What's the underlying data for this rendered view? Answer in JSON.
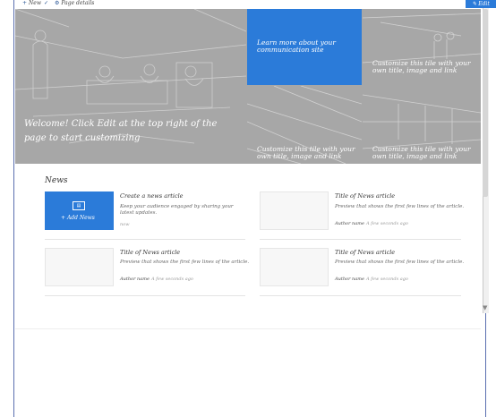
{
  "command_bar": {
    "new_label": "New",
    "details_label": "Page details",
    "edit_label": "Edit",
    "icons": [
      "plus-icon",
      "check-icon",
      "gear-icon",
      "pencil-icon"
    ]
  },
  "hero": {
    "main_text": "Welcome! Click Edit at the top right of the page to start customizing",
    "blue_tile_text": "Learn more about your communication site",
    "tile_top_right_text": "Customize this tile with your own title, image and link",
    "tile_bottom_mid_text": "Customize this tile with your own title, image and link",
    "tile_bottom_right_text": "Customize this tile with your own title, image and link",
    "colors": {
      "accent": "#2b7bd9",
      "hero_gray": "#a7a7a7"
    }
  },
  "news": {
    "section_title": "News",
    "add_news_label": "Add News",
    "items": [
      {
        "title": "Create a news article",
        "description": "Keep your audience engaged by sharing your latest updates.",
        "author": "",
        "time": "now"
      },
      {
        "title": "Title of News article",
        "description": "Preview that shows the first few lines of the article.",
        "author": "Author name",
        "time": "A few seconds ago"
      },
      {
        "title": "Title of News article",
        "description": "Preview that shows the first few lines of the article.",
        "author": "Author name",
        "time": "A few seconds ago"
      },
      {
        "title": "Title of News article",
        "description": "Preview that shows the first few lines of the article.",
        "author": "Author name",
        "time": "A few seconds ago"
      }
    ]
  }
}
